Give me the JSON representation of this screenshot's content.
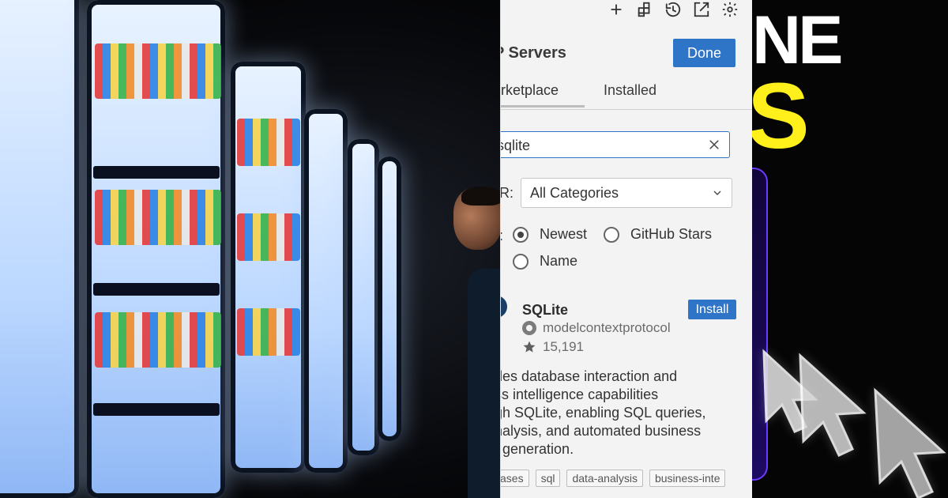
{
  "toolbar": {
    "icons": [
      "plus-icon",
      "extensions-icon",
      "history-icon",
      "open-external-icon",
      "gear-icon"
    ]
  },
  "header": {
    "title": "P Servers",
    "done_label": "Done"
  },
  "tabs": [
    {
      "label": "arketplace",
      "active": true
    },
    {
      "label": "Installed",
      "active": false
    }
  ],
  "search": {
    "value": "sqlite",
    "clear_icon": "close-icon"
  },
  "filter": {
    "label": "R:",
    "selected": "All Categories"
  },
  "sort": {
    "label": ":",
    "options": [
      {
        "label": "Newest",
        "selected": true
      },
      {
        "label": "GitHub Stars",
        "selected": false
      },
      {
        "label": "Name",
        "selected": false
      }
    ]
  },
  "server": {
    "name": "SQLite",
    "install_label": "Install",
    "owner": "modelcontextprotocol",
    "stars": "15,191",
    "description_lines": [
      "des database interaction and",
      "ss intelligence capabilities",
      "gh SQLite, enabling SQL queries,",
      "nalysis, and automated business",
      "t generation."
    ],
    "tags": [
      "ases",
      "sql",
      "data-analysis",
      "business-inte"
    ]
  },
  "promo": {
    "white_text": "NE",
    "yellow_text": "S"
  },
  "colors": {
    "accent_blue": "#2f75c7",
    "promo_yellow": "#ffef1a",
    "promo_purple": "#6b3cff"
  }
}
